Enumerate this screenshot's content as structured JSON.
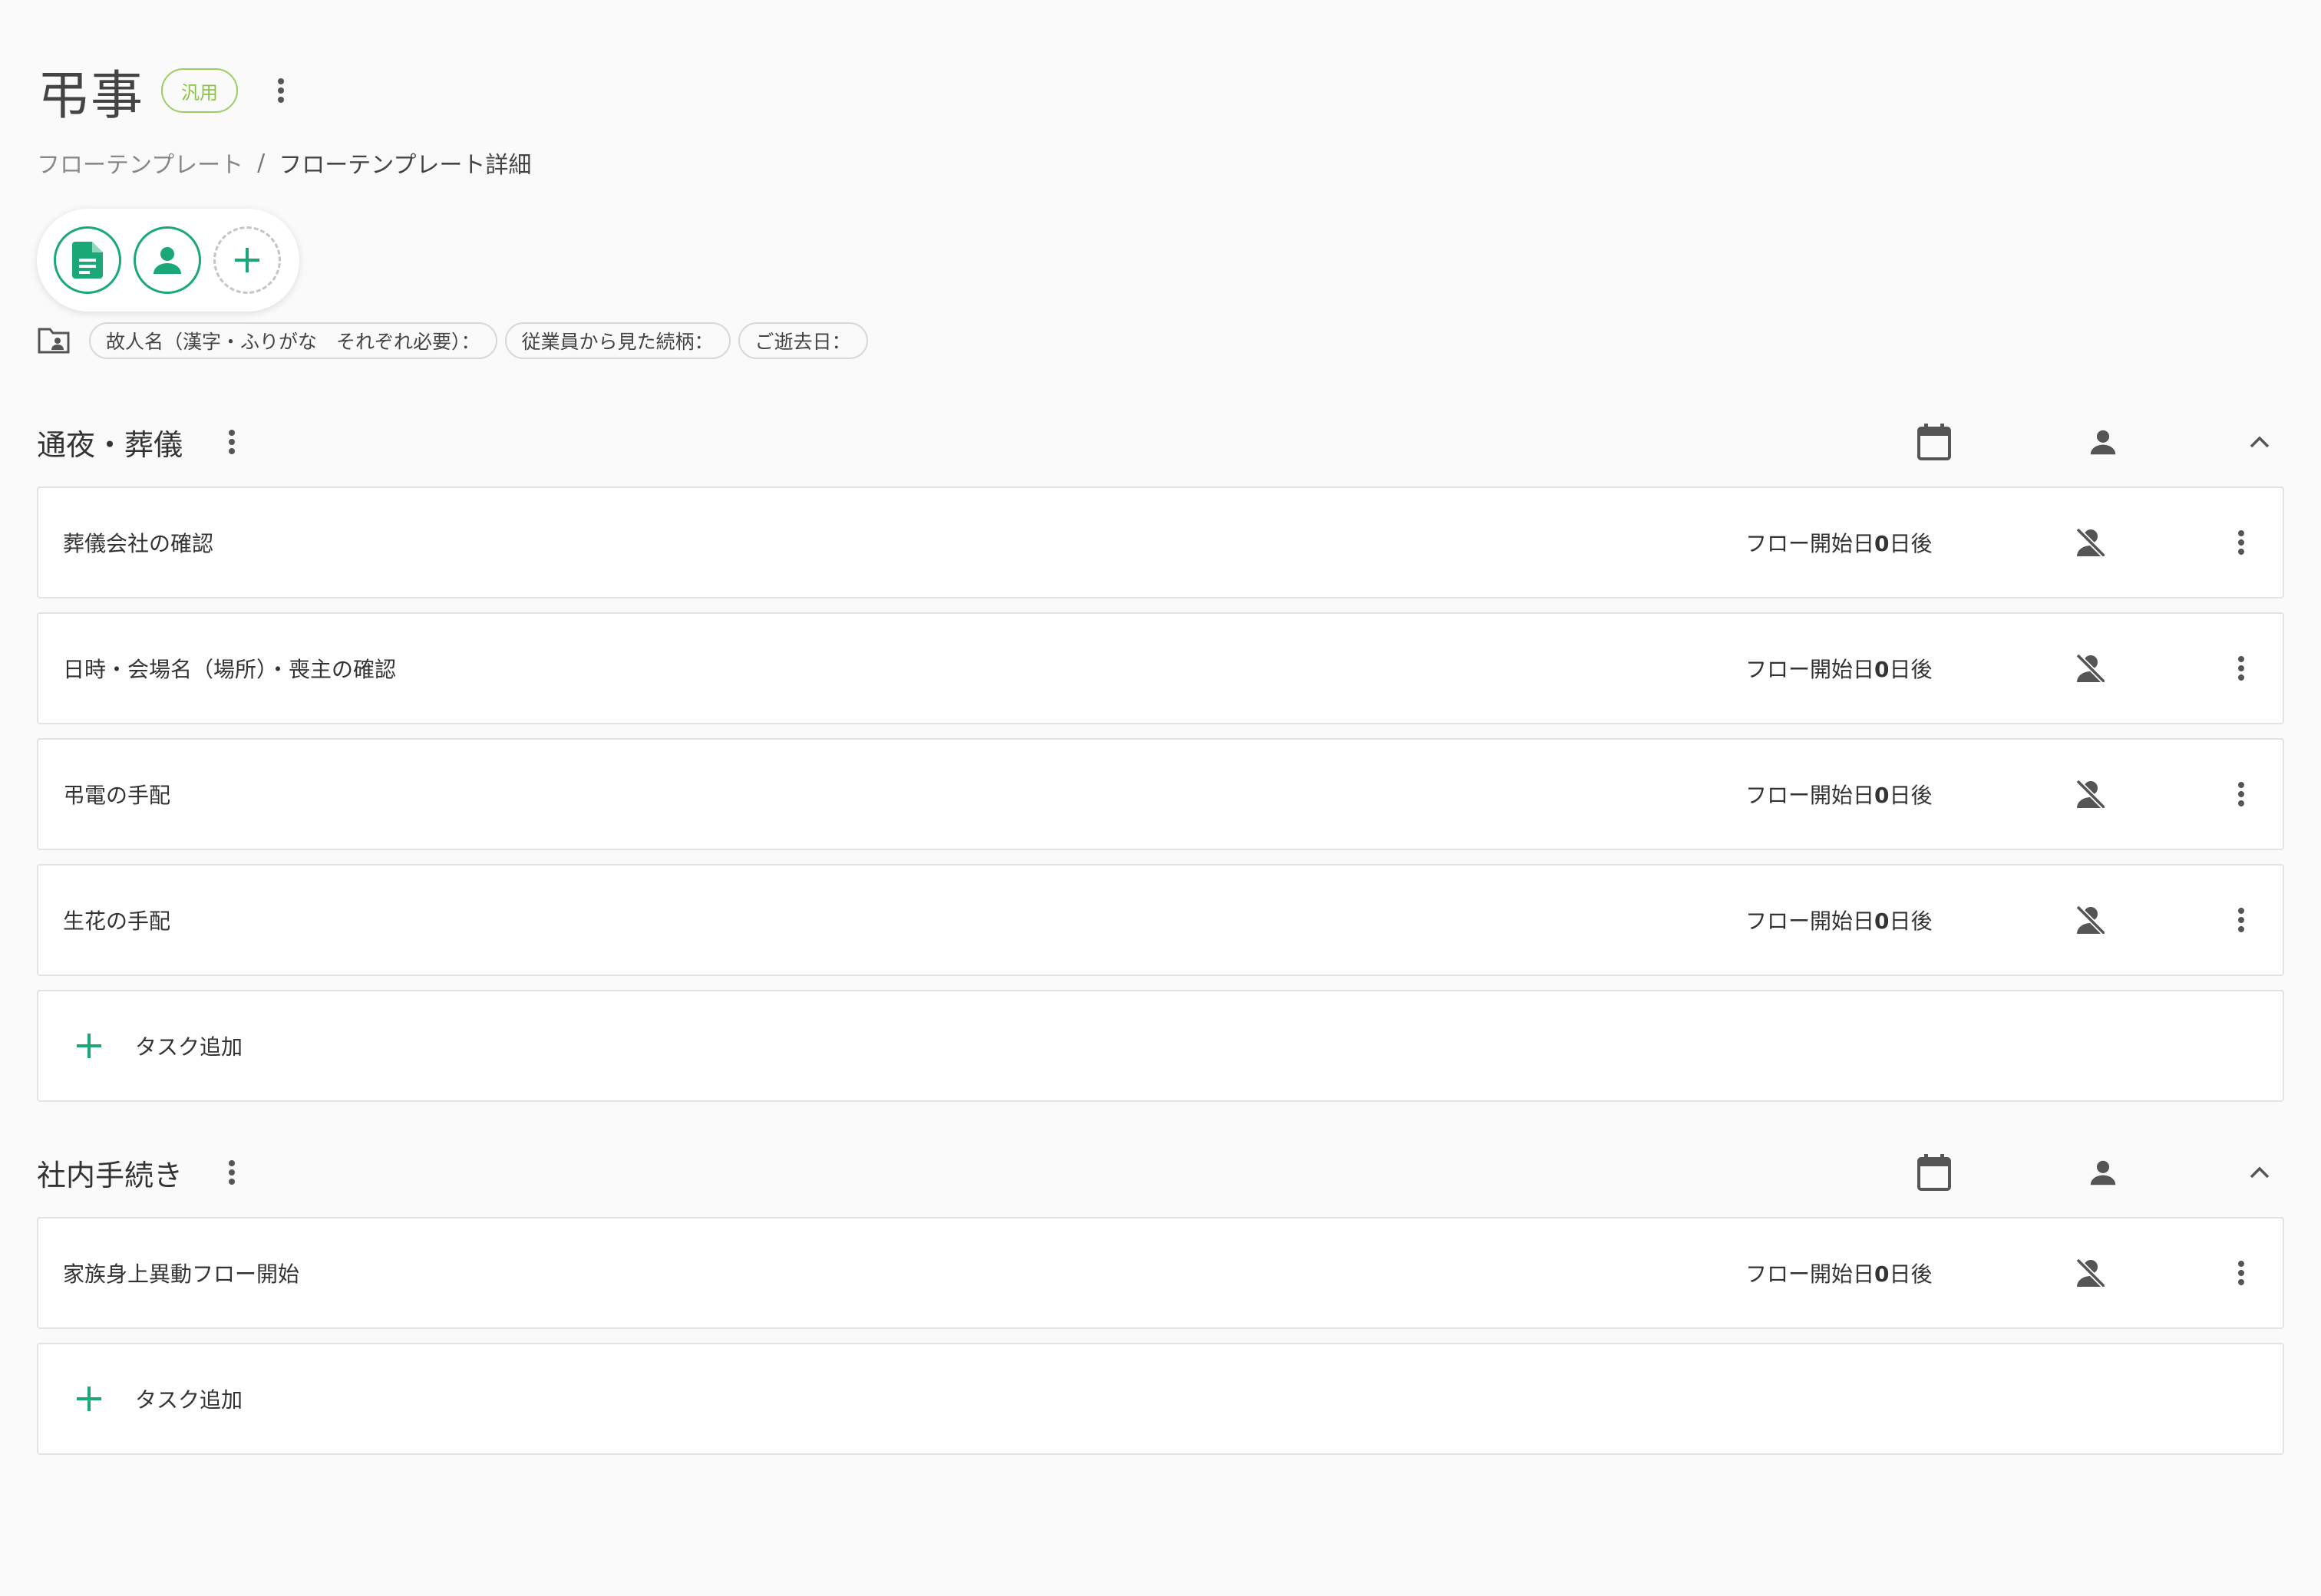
{
  "header": {
    "title": "弔事",
    "badge": "汎用",
    "more_icon": "kebab-icon"
  },
  "breadcrumb": {
    "parent": "フローテンプレート",
    "separator": "/",
    "current": "フローテンプレート詳細"
  },
  "roles": [
    {
      "icon": "document-icon"
    },
    {
      "icon": "person-icon"
    },
    {
      "icon": "add-icon"
    }
  ],
  "fields": {
    "icon": "folder-person-icon",
    "chips": [
      "故人名（漢字・ふりがな　それぞれ必要）：",
      "従業員から見た続柄：",
      "ご逝去日："
    ]
  },
  "sections": [
    {
      "title": "通夜・葬儀",
      "tasks": [
        {
          "name": "葬儀会社の確認",
          "due_prefix": "フロー開始日",
          "due_days": "0",
          "due_suffix": "日後"
        },
        {
          "name": "日時・会場名（場所）・喪主の確認",
          "due_prefix": "フロー開始日",
          "due_days": "0",
          "due_suffix": "日後"
        },
        {
          "name": "弔電の手配",
          "due_prefix": "フロー開始日",
          "due_days": "0",
          "due_suffix": "日後"
        },
        {
          "name": "生花の手配",
          "due_prefix": "フロー開始日",
          "due_days": "0",
          "due_suffix": "日後"
        }
      ],
      "add_label": "タスク追加"
    },
    {
      "title": "社内手続き",
      "tasks": [
        {
          "name": "家族身上異動フロー開始",
          "due_prefix": "フロー開始日",
          "due_days": "0",
          "due_suffix": "日後"
        }
      ],
      "add_label": "タスク追加"
    }
  ],
  "colors": {
    "accent": "#19a876",
    "badge": "#8bc34a",
    "icon_dark": "#555555"
  }
}
